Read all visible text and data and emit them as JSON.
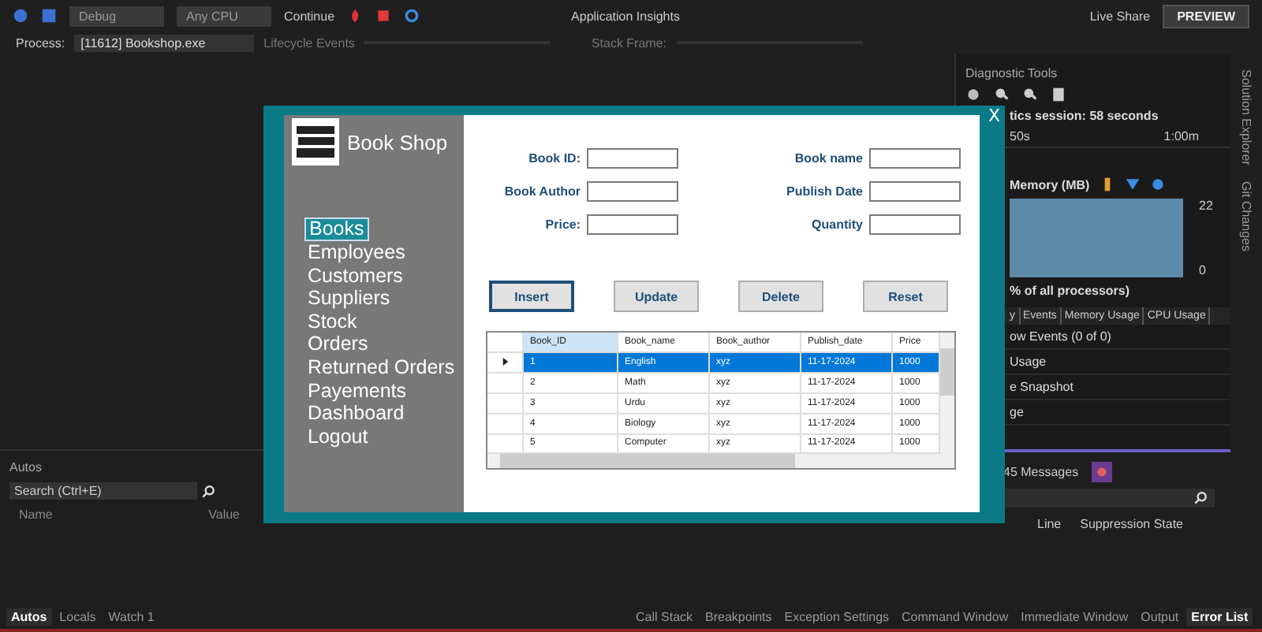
{
  "toolbar": {
    "configuration": "Debug",
    "platform": "Any CPU",
    "continue": "Continue",
    "insights": "Application Insights",
    "live_share": "Live Share",
    "preview": "PREVIEW"
  },
  "debug_bar": {
    "process_label": "Process:",
    "process": "[11612] Bookshop.exe",
    "lifecycle": "Lifecycle Events",
    "stack_frame_label": "Stack Frame:"
  },
  "diagnostic_tools": {
    "title": "Diagnostic Tools",
    "session": "tics session: 58 seconds",
    "ticks": [
      "50s",
      "1:00m"
    ],
    "memory_title": "Memory (MB)",
    "memory_max": "22",
    "memory_min": "0",
    "cpu_caption": "% of all processors)",
    "tabs": [
      "y",
      "Events",
      "Memory Usage",
      "CPU Usage"
    ],
    "items": [
      "ow Events (0 of 0)",
      "Usage",
      "e Snapshot",
      "ge"
    ]
  },
  "side_tabs": [
    "Solution Explorer",
    "Git Changes"
  ],
  "autos": {
    "title": "Autos",
    "search": {
      "placeholder": "Search (Ctrl+E)"
    },
    "columns": [
      "Name",
      "Value"
    ],
    "tabs": [
      {
        "label": "Autos",
        "selected": true
      },
      {
        "label": "Locals",
        "selected": false
      },
      {
        "label": "Watch 1",
        "selected": false
      }
    ]
  },
  "error_list": {
    "messages": "45 Messages",
    "columns": [
      "Line",
      "Suppression State"
    ],
    "tabs": [
      {
        "label": "Call Stack",
        "selected": false
      },
      {
        "label": "Breakpoints",
        "selected": false
      },
      {
        "label": "Exception Settings",
        "selected": false
      },
      {
        "label": "Command Window",
        "selected": false
      },
      {
        "label": "Immediate Window",
        "selected": false
      },
      {
        "label": "Output",
        "selected": false
      },
      {
        "label": "Error List",
        "selected": true
      }
    ]
  },
  "dialog": {
    "title": "Book Shop",
    "close": "X",
    "menu": [
      {
        "label": "Books",
        "selected": true
      },
      {
        "label": "Employees",
        "selected": false
      },
      {
        "label": "Customers",
        "selected": false
      },
      {
        "label": "Suppliers",
        "selected": false
      },
      {
        "label": "Stock",
        "selected": false
      },
      {
        "label": "Orders",
        "selected": false
      },
      {
        "label": "Returned Orders",
        "selected": false
      },
      {
        "label": "Payements",
        "selected": false
      },
      {
        "label": "Dashboard",
        "selected": false
      },
      {
        "label": "Logout",
        "selected": false
      }
    ],
    "fields": [
      {
        "label": "Book ID:"
      },
      {
        "label": "Book name"
      },
      {
        "label": "Book Author"
      },
      {
        "label": "Publish Date"
      },
      {
        "label": "Price:"
      },
      {
        "label": "Quantity"
      }
    ],
    "buttons": [
      {
        "label": "Insert",
        "focused": true
      },
      {
        "label": "Update",
        "focused": false
      },
      {
        "label": "Delete",
        "focused": false
      },
      {
        "label": "Reset",
        "focused": false
      }
    ],
    "table": {
      "columns": [
        "Book_ID",
        "Book_name",
        "Book_author",
        "Publish_date",
        "Price"
      ],
      "rows": [
        {
          "cells": [
            "1",
            "English",
            "xyz",
            "11-17-2024",
            "1000"
          ],
          "selected": true
        },
        {
          "cells": [
            "2",
            "Math",
            "xyz",
            "11-17-2024",
            "1000"
          ],
          "selected": false
        },
        {
          "cells": [
            "3",
            "Urdu",
            "xyz",
            "11-17-2024",
            "1000"
          ],
          "selected": false
        },
        {
          "cells": [
            "4",
            "Biology",
            "xyz",
            "11-17-2024",
            "1000"
          ],
          "selected": false
        },
        {
          "cells": [
            "5",
            "Computer",
            "xyz",
            "11-17-2024",
            "1000"
          ],
          "selected": false
        }
      ]
    }
  }
}
